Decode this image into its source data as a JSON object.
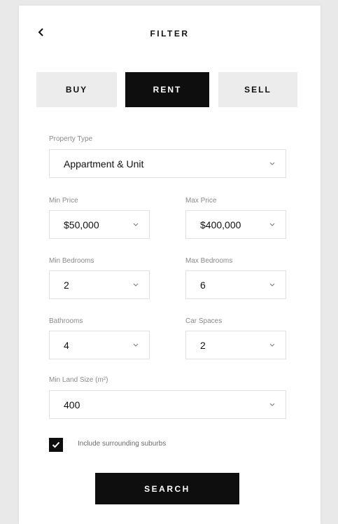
{
  "header": {
    "title": "FILTER"
  },
  "tabs": [
    {
      "label": "BUY",
      "active": false
    },
    {
      "label": "RENT",
      "active": true
    },
    {
      "label": "SELL",
      "active": false
    }
  ],
  "fields": {
    "property_type": {
      "label": "Property Type",
      "value": "Appartment & Unit"
    },
    "min_price": {
      "label": "Min Price",
      "value": "$50,000"
    },
    "max_price": {
      "label": "Max Price",
      "value": "$400,000"
    },
    "min_bedrooms": {
      "label": "Min Bedrooms",
      "value": "2"
    },
    "max_bedrooms": {
      "label": "Max Bedrooms",
      "value": "6"
    },
    "bathrooms": {
      "label": "Bathrooms",
      "value": "4"
    },
    "car_spaces": {
      "label": "Car Spaces",
      "value": "2"
    },
    "min_land_size": {
      "label": "Min Land Size (m²)",
      "value": "400"
    }
  },
  "options": {
    "include_surrounding": {
      "label": "Include surrounding suburbs",
      "checked": true
    }
  },
  "actions": {
    "search_label": "SEARCH"
  },
  "icons": {
    "back": "chevron-left-icon",
    "dropdown": "chevron-down-icon",
    "check": "checkmark-icon"
  },
  "colors": {
    "primary": "#0e0e0e",
    "tab_inactive": "#ececec",
    "label": "#8a8a8a",
    "border": "#e0e0e0"
  }
}
